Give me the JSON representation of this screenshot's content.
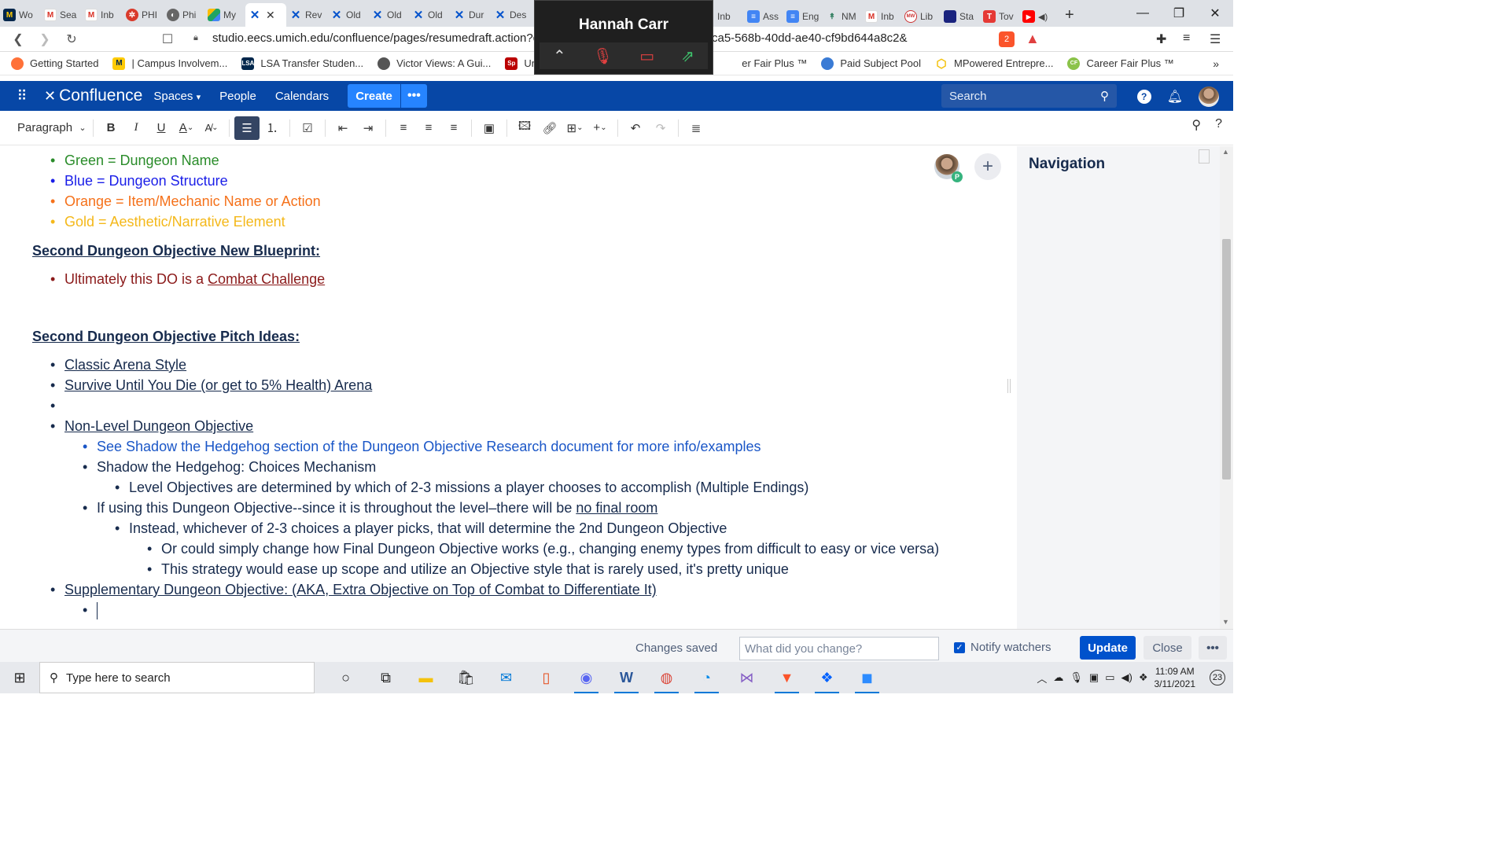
{
  "browser": {
    "tabs": [
      {
        "label": "Wo",
        "icon": "umich-icon",
        "color": "#00274c"
      },
      {
        "label": "Sea",
        "icon": "gmail-icon",
        "color": "#ffffff"
      },
      {
        "label": "Inb",
        "icon": "gmail-icon",
        "color": "#ffffff"
      },
      {
        "label": "PHI",
        "icon": "phi-icon",
        "color": "#d93a2b"
      },
      {
        "label": "Phi",
        "icon": "phi-icon",
        "color": "#666666"
      },
      {
        "label": "My",
        "icon": "drive-icon",
        "color": "#1fa463"
      },
      {
        "label": "",
        "icon": "confluence-icon",
        "color": "#0052cc"
      },
      {
        "label": "Rev",
        "icon": "confluence-icon",
        "color": "#0052cc"
      },
      {
        "label": "Old",
        "icon": "confluence-icon",
        "color": "#0052cc"
      },
      {
        "label": "Old",
        "icon": "confluence-icon",
        "color": "#0052cc"
      },
      {
        "label": "Old",
        "icon": "confluence-icon",
        "color": "#0052cc"
      },
      {
        "label": "Dur",
        "icon": "confluence-icon",
        "color": "#0052cc"
      },
      {
        "label": "Des",
        "icon": "confluence-icon",
        "color": "#0052cc"
      }
    ],
    "right_tabs": [
      {
        "label": "Inb",
        "icon": "gmail-icon"
      },
      {
        "label": "Ass",
        "icon": "docs-icon"
      },
      {
        "label": "Eng",
        "icon": "docs-icon"
      },
      {
        "label": "NM",
        "icon": "nm-icon"
      },
      {
        "label": "Inb",
        "icon": "gmail-icon"
      },
      {
        "label": "Lib",
        "icon": "lib-icon"
      },
      {
        "label": "Sta",
        "icon": "sta-icon"
      },
      {
        "label": "Tov",
        "icon": "tov-icon"
      },
      {
        "label": "",
        "icon": "youtube-icon"
      }
    ],
    "url_start": "studio.eecs.umich.edu/confluence/pages/resumedraft.action?dra",
    "url_end": "ca5-568b-40dd-ae40-cf9bd644a8c2&",
    "brave_badge": "2",
    "bookmarks": [
      {
        "label": "Getting Started",
        "icon": "firefox-icon"
      },
      {
        "label": "| Campus Involvem...",
        "icon": "umich-icon"
      },
      {
        "label": "LSA Transfer Studen...",
        "icon": "lsa-icon"
      },
      {
        "label": "Victor Views: A Gui...",
        "icon": "globe-icon"
      },
      {
        "label": "Universi",
        "icon": "sp-icon"
      },
      {
        "label": "er Fair Plus ™",
        "icon": ""
      },
      {
        "label": "Paid Subject Pool",
        "icon": "globe-icon"
      },
      {
        "label": "MPowered Entrepre...",
        "icon": "hex-icon"
      },
      {
        "label": "Career Fair Plus ™",
        "icon": "cf-icon"
      }
    ]
  },
  "zoom": {
    "participant": "Hannah Carr"
  },
  "confluence": {
    "logo_text": "Confluence",
    "nav": [
      "Spaces",
      "People",
      "Calendars"
    ],
    "create_label": "Create",
    "more_label": "•••",
    "search_placeholder": "Search"
  },
  "toolbar": {
    "paragraph_label": "Paragraph"
  },
  "editor": {
    "legend": [
      {
        "text": "Green = Dungeon Name",
        "color": "#2a8c2a"
      },
      {
        "text": "Blue = Dungeon Structure",
        "color": "#1a1ee8"
      },
      {
        "text": "Orange = Item/Mechanic Name or Action",
        "color": "#f5711a"
      },
      {
        "text": "Gold = Aesthetic/Narrative Element",
        "color": "#f4b81a"
      }
    ],
    "heading_blueprint": "Second Dungeon Objective New Blueprint:",
    "blueprint_prefix": "Ultimately this DO is a ",
    "blueprint_link": "Combat Challenge",
    "heading_pitch": "Second Dungeon Objective Pitch Ideas:",
    "pitch_1": "Classic Arena Style",
    "pitch_2": "Survive Until You Die (or get to 5% Health) Arena",
    "pitch_3": "Non-Level Dungeon Objective",
    "sub_research": "See Shadow the Hedgehog section of the Dungeon Objective Research document for more info/examples",
    "sub_shadow": "Shadow the Hedgehog: Choices Mechanism",
    "sub_shadow_detail": "Level Objectives are determined by which of 2-3 missions a player chooses to accomplish (Multiple Endings)",
    "sub_if_prefix": "If using this Dungeon Objective--since it is throughout the level–there will be ",
    "sub_if_underline": "no final room",
    "sub_instead": "Instead, whichever of 2-3 choices a player picks, that will determine the 2nd Dungeon Objective",
    "sub_or": "Or could simply change how Final Dungeon Objective works (e.g., changing enemy types from difficult to easy or vice versa)",
    "sub_strategy": "This strategy would ease up scope and utilize an Objective style that is rarely used, it's pretty unique",
    "pitch_4": "Supplementary Dungeon Objective: (AKA, Extra Objective on Top of Combat to Differentiate It)"
  },
  "collaborator_badge": "P",
  "navigation": {
    "title": "Navigation"
  },
  "savebar": {
    "status": "Changes saved",
    "comment_placeholder": "What did you change?",
    "notify_label": "Notify watchers",
    "update_label": "Update",
    "close_label": "Close",
    "more_label": "•••"
  },
  "taskbar": {
    "search_placeholder": "Type here to search",
    "time": "11:09 AM",
    "date": "3/11/2021",
    "notifications": "23"
  }
}
